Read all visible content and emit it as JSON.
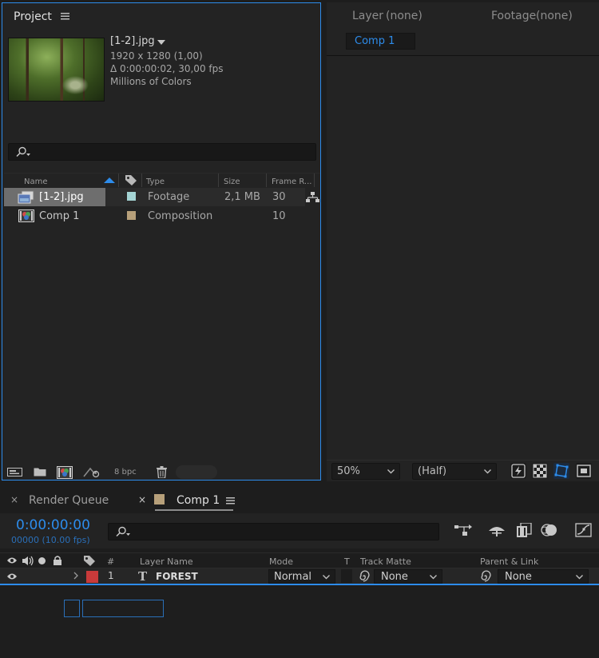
{
  "project": {
    "tab_title": "Project",
    "file_name": "[1-2].jpg",
    "meta_resolution": "1920 x 1280 (1,00)",
    "meta_duration": "Δ 0:00:00:02, 30,00 fps",
    "meta_colors": "Millions of Colors",
    "columns": {
      "name": "Name",
      "type": "Type",
      "size": "Size",
      "frame_rate": "Frame R..."
    },
    "items": [
      {
        "name": "[1-2].jpg",
        "type": "Footage",
        "size": "2,1 MB",
        "frame_rate": "30",
        "label_color": "#a4d4d4"
      },
      {
        "name": "Comp 1",
        "type": "Composition",
        "size": "",
        "frame_rate": "10",
        "label_color": "#b7a07a"
      }
    ],
    "bpc": "8 bpc"
  },
  "viewer": {
    "layer_label": "Layer",
    "layer_value": "(none)",
    "footage_label": "Footage",
    "footage_value": "(none)",
    "comp_tab": "Comp 1",
    "zoom": "50%",
    "resolution": "(Half)"
  },
  "timeline": {
    "render_queue_tab": "Render Queue",
    "comp_tab": "Comp 1",
    "timecode": "0:00:00:00",
    "frame_info": "00000 (10.00 fps)",
    "columns": {
      "hash": "#",
      "layer_name": "Layer Name",
      "mode": "Mode",
      "t": "T",
      "track_matte": "Track Matte",
      "parent_link": "Parent & Link"
    },
    "layer": {
      "number": "1",
      "name": "FOREST",
      "mode": "Normal",
      "track_matte": "None",
      "parent": "None",
      "label_color": "#c83a3a"
    }
  },
  "colors": {
    "accent": "#2d8ceb",
    "timecode": "#2d8ceb"
  }
}
